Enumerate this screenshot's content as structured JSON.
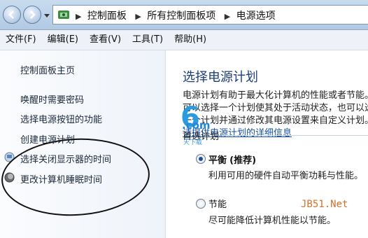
{
  "window": {
    "breadcrumbs": [
      "控制面板",
      "所有控制面板项",
      "电源选项"
    ]
  },
  "menubar": [
    "文件(F)",
    "编辑(E)",
    "查看(V)",
    "工具(T)",
    "帮助(H)"
  ],
  "sidebar": {
    "home": "控制面板主页",
    "links": [
      "唤醒时需要密码",
      "选择电源按钮的功能",
      "创建电源计划",
      "选择关闭显示器的时间",
      "更改计算机睡眠时间"
    ]
  },
  "main": {
    "title": "选择电源计划",
    "description": "电源计划有助于最大化计算机的性能或者节能。您可以选择一个计划使其处于活动状态，也可以选择一个计划并通过修改其电源设置来自定义计划。",
    "link": "请提供电源计划的详细信息",
    "group_label": "首选计划",
    "plans": [
      {
        "name": "平衡",
        "tag": "(推荐)",
        "desc": "利用可用的硬件自动平衡功耗与性能。",
        "selected": true
      },
      {
        "name": "节能",
        "tag": "",
        "desc": "尽可能降低计算机性能以节能。",
        "selected": false
      }
    ]
  },
  "watermarks": {
    "six": "6",
    "com": ".com",
    "six_sub": "天下载",
    "jb51": "JB51.Net"
  },
  "colors": {
    "title_blue": "#1e3d7a",
    "link_blue": "#1a52a6",
    "watermark_orange": "#d4712a",
    "watermark_blue": "#2a9be0"
  }
}
